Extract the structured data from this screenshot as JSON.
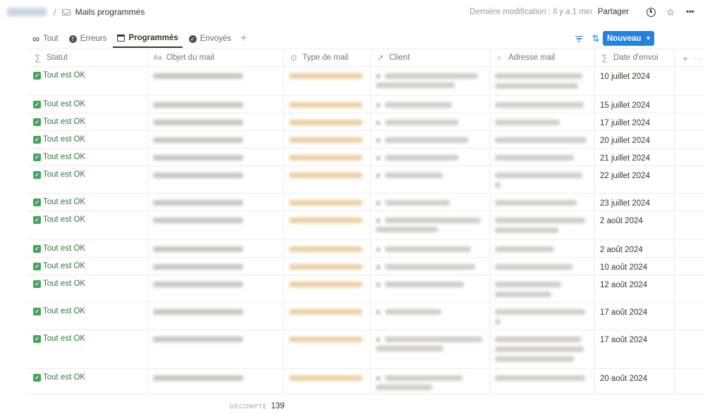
{
  "breadcrumb": {
    "page_title": "Mails programmés",
    "separator": "/"
  },
  "topbar": {
    "last_edit": "Dernière modification : Il y a 1 min",
    "share_label": "Partager",
    "more_label": "•••"
  },
  "tabs": [
    {
      "label": "Tout",
      "icon": "infinity-icon"
    },
    {
      "label": "Erreurs",
      "icon": "alert-circle-icon"
    },
    {
      "label": "Programmés",
      "icon": "calendar-icon",
      "active": true
    },
    {
      "label": "Envoyés",
      "icon": "check-circle-icon"
    }
  ],
  "toolbar": {
    "new_label": "Nouveau",
    "more_label": "···"
  },
  "colors": {
    "accent": "#2383e2",
    "status_green": "#2b7a3d",
    "check_bg": "#3fa75a"
  },
  "table": {
    "columns": [
      {
        "label": "Statut",
        "icon": "sigma-icon"
      },
      {
        "label": "Objet du mail",
        "icon": "text-icon"
      },
      {
        "label": "Type de mail",
        "icon": "select-icon"
      },
      {
        "label": "Client",
        "icon": "relation-arrow-icon"
      },
      {
        "label": "Adresse mail",
        "icon": "search-icon"
      },
      {
        "label": "Date d'envoi",
        "icon": "sigma-icon"
      }
    ],
    "rows": [
      {
        "status": "Tout est OK",
        "date": "10 juillet 2024",
        "client_lines": 2,
        "mail_lines": 2
      },
      {
        "status": "Tout est OK",
        "date": "15 juillet 2024",
        "client_lines": 1,
        "mail_lines": 1
      },
      {
        "status": "Tout est OK",
        "date": "17 juillet 2024",
        "client_lines": 1,
        "mail_lines": 1
      },
      {
        "status": "Tout est OK",
        "date": "20 juillet 2024",
        "client_lines": 1,
        "mail_lines": 1
      },
      {
        "status": "Tout est OK",
        "date": "21 juillet 2024",
        "client_lines": 1,
        "mail_lines": 1
      },
      {
        "status": "Tout est OK",
        "date": "22 juillet 2024",
        "client_lines": 1,
        "mail_lines": 2
      },
      {
        "status": "Tout est OK",
        "date": "23 juillet 2024",
        "client_lines": 1,
        "mail_lines": 1
      },
      {
        "status": "Tout est OK",
        "date": "2 août 2024",
        "client_lines": 2,
        "mail_lines": 2
      },
      {
        "status": "Tout est OK",
        "date": "2 août 2024",
        "client_lines": 1,
        "mail_lines": 1
      },
      {
        "status": "Tout est OK",
        "date": "10 août 2024",
        "client_lines": 1,
        "mail_lines": 1
      },
      {
        "status": "Tout est OK",
        "date": "12 août 2024",
        "client_lines": 1,
        "mail_lines": 2
      },
      {
        "status": "Tout est OK",
        "date": "17 août 2024",
        "client_lines": 1,
        "mail_lines": 2
      },
      {
        "status": "Tout est OK",
        "date": "17 août 2024",
        "client_lines": 2,
        "mail_lines": 3
      },
      {
        "status": "Tout est OK",
        "date": "20 août 2024",
        "client_lines": 2,
        "mail_lines": 1
      }
    ]
  },
  "footer": {
    "count_label": "DÉCOMPTE",
    "count_value": "139"
  }
}
